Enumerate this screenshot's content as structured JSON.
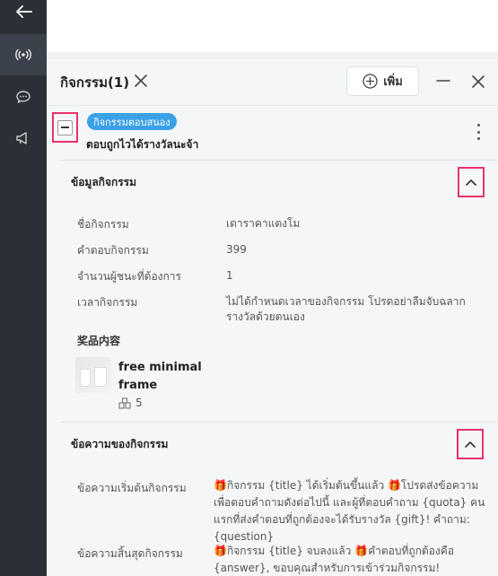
{
  "panel": {
    "title": "กิจกรรม(1)",
    "add_label": "เพิ่ม"
  },
  "card": {
    "badge": "กิจกรรมตอบสนอง",
    "subtitle": "ตอบถูกไวได้รางวัลนะจ้า"
  },
  "info_section": {
    "title": "ข้อมูลกิจกรรม",
    "rows": [
      {
        "label": "ชื่อกิจกรรม",
        "value": "เดาราคาแตงโม"
      },
      {
        "label": "คำตอบกิจกรรม",
        "value": "399"
      },
      {
        "label": "จำนวนผู้ชนะที่ต้องการ",
        "value": "1"
      },
      {
        "label": "เวลากิจกรรม",
        "value": "ไม่ได้กำหนดเวลาของกิจกรรม โปรดอย่าลืมจับฉลากรางวัลด้วยตนเอง"
      }
    ],
    "prize_heading": "奖品内容",
    "prize": {
      "name": "free minimal frame",
      "quantity": "5"
    }
  },
  "message_section": {
    "title": "ข้อความของกิจกรรม",
    "rows": [
      {
        "label": "ข้อความเริ่มต้นกิจกรรม",
        "value": "🎁กิจกรรม {title} ได้เริ่มต้นขึ้นแล้ว 🎁โปรดส่งข้อความเพื่อตอบคำถามดังต่อไปนี้ และผู้ที่ตอบคำถาม {quota} คนแรกที่ส่งคำตอบที่ถูกต้องจะได้รับรางวัล {gift}! คำถาม: {question}"
      },
      {
        "label": "ข้อความสิ้นสุดกิจกรรม",
        "value": "🎁กิจกรรม {title} จบลงแล้ว 🎁คำตอบที่ถูกต้องคือ {answer}, ขอบคุณสำหรับการเข้าร่วมกิจกรรม!"
      }
    ]
  },
  "icons": {
    "rail": [
      "back-arrow-icon",
      "broadcast-icon",
      "chat-bubble-icon",
      "megaphone-icon"
    ],
    "highlight_color": "#e8336b",
    "badge_color": "#3aa1e6",
    "rail_color": "#2b3037"
  }
}
